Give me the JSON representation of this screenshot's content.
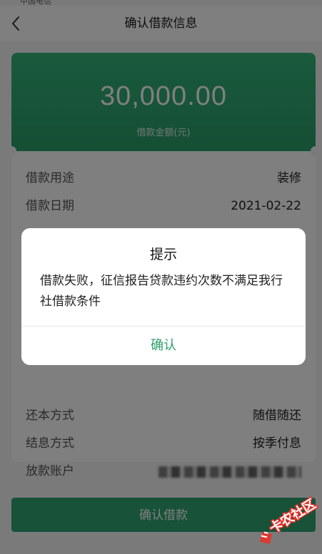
{
  "status_bar": {
    "carrier": "中国电信"
  },
  "navbar": {
    "title": "确认借款信息",
    "back_icon": "chevron-left-icon"
  },
  "amount": {
    "value": "30,000.00",
    "label": "借款金额(元)"
  },
  "info_rows": [
    {
      "label": "借款用途",
      "value": "装修"
    },
    {
      "label": "借款日期",
      "value": "2021-02-22"
    },
    {
      "label": "还本方式",
      "value": "随借随还"
    },
    {
      "label": "结息方式",
      "value": "按季付息"
    },
    {
      "label": "放款账户",
      "value": ""
    }
  ],
  "confirm_loan_label": "确认借款",
  "dialog": {
    "title": "提示",
    "message": "借款失败，征信报告贷款违约次数不满足我行社借款条件",
    "confirm_label": "确认"
  },
  "watermark": {
    "text": "卡农社区",
    "color": "#e8322a"
  },
  "colors": {
    "accent": "#2ea572",
    "card_gradient_top": "#34b47a"
  }
}
